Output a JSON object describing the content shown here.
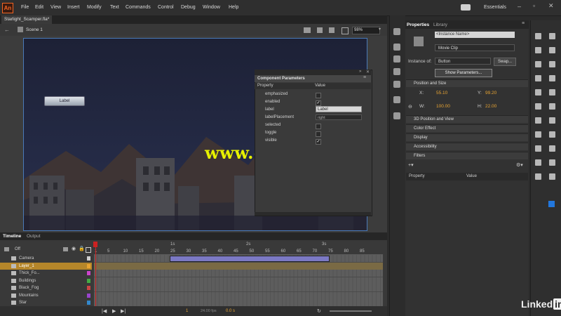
{
  "app": {
    "logo": "An",
    "workspace": "Essentials"
  },
  "menu": [
    "File",
    "Edit",
    "View",
    "Insert",
    "Modify",
    "Text",
    "Commands",
    "Control",
    "Debug",
    "Window",
    "Help"
  ],
  "document": {
    "tab": "Starlight_Scamper.fla*",
    "scene": "Scene 1",
    "zoom": "98%"
  },
  "stage": {
    "button_label": "Label",
    "watermark": "www.cgtsj.com"
  },
  "component_parameters": {
    "title": "Component Parameters",
    "col_property": "Property",
    "col_value": "Value",
    "rows": [
      {
        "name": "emphasized",
        "checked": false
      },
      {
        "name": "enabled",
        "checked": true
      },
      {
        "name": "label",
        "value": "Label"
      },
      {
        "name": "labelPlacement",
        "value": "right"
      },
      {
        "name": "selected",
        "checked": false
      },
      {
        "name": "toggle",
        "checked": false
      },
      {
        "name": "visible",
        "checked": true
      }
    ]
  },
  "timeline": {
    "tabs": [
      "Timeline",
      "Output"
    ],
    "onion": "Off",
    "seconds": [
      "1s",
      "2s",
      "3s"
    ],
    "frame_ticks": [
      "1",
      "5",
      "10",
      "15",
      "20",
      "25",
      "30",
      "35",
      "40",
      "45",
      "50",
      "55",
      "60",
      "65",
      "70",
      "75",
      "80",
      "85"
    ],
    "layers": [
      {
        "name": "Camera",
        "color": "#cfcfcf"
      },
      {
        "name": "Layer_1",
        "color": "#e8a432"
      },
      {
        "name": "Thick_Fo...",
        "color": "#cc44cc"
      },
      {
        "name": "Buildings",
        "color": "#44aa44"
      },
      {
        "name": "Black_Fog",
        "color": "#cc4444"
      },
      {
        "name": "Mountains",
        "color": "#9944cc"
      },
      {
        "name": "Star",
        "color": "#3388cc"
      }
    ],
    "current_frame": "1",
    "fps": "24.00 fps",
    "elapsed": "0.0 s"
  },
  "properties": {
    "tabs": [
      "Properties",
      "Library"
    ],
    "instance_name_placeholder": "<Instance Name>",
    "symbol_type": "Movie Clip",
    "instance_of_label": "Instance of:",
    "instance_of": "Button",
    "swap": "Swap...",
    "show_parameters": "Show Parameters...",
    "position_size": "Position and Size",
    "x_label": "X:",
    "x": "55.10",
    "y_label": "Y:",
    "y": "99.20",
    "w_label": "W:",
    "w": "100.00",
    "h_label": "H:",
    "h": "22.00",
    "sections": [
      "3D Position and View",
      "Color Effect",
      "Display",
      "Accessibility",
      "Filters"
    ],
    "filters_col_property": "Property",
    "filters_col_value": "Value"
  },
  "brand": {
    "linked": "Linked",
    "in": "in"
  }
}
